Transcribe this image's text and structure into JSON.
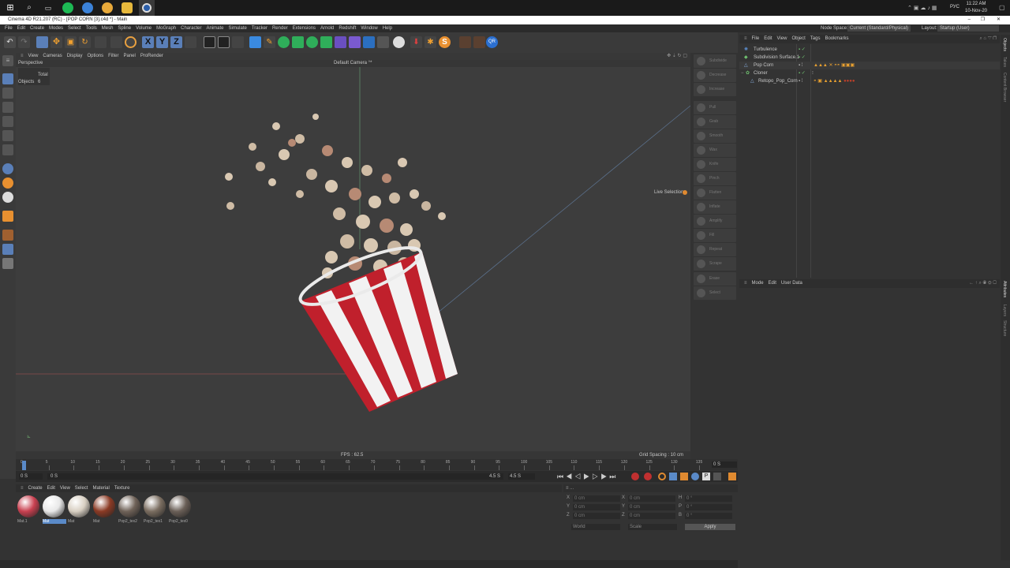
{
  "taskbar": {
    "time": "11:22 AM",
    "date": "10-Nov-20",
    "lang": "РУС"
  },
  "window": {
    "title": "Cinema 4D R21.207 (RC) - [POP CORN [3].c4d *] - Main"
  },
  "menu": [
    "File",
    "Edit",
    "Create",
    "Modes",
    "Select",
    "Tools",
    "Mesh",
    "Spline",
    "Volume",
    "MoGraph",
    "Character",
    "Animate",
    "Simulate",
    "Tracker",
    "Render",
    "Extensions",
    "Arnold",
    "Redshift",
    "Window",
    "Help"
  ],
  "nodespace": {
    "label": "Node Space:",
    "value": "Current (Standard/Physical)"
  },
  "layout": {
    "label": "Layout:",
    "value": "Startup (User)"
  },
  "viewport": {
    "menu": [
      "View",
      "Cameras",
      "Display",
      "Options",
      "Filter",
      "Panel",
      "ProRender"
    ],
    "projection": "Perspective",
    "camera": "Default Camera °*",
    "stats_total": "Total",
    "stats_objects_label": "Objects",
    "stats_objects_value": "6",
    "live_selection": "Live Selection",
    "fps": "FPS : 62.5",
    "grid_spacing": "Grid Spacing : 10 cm"
  },
  "sculpt": [
    "Subdivide",
    "Decrease",
    "Increase",
    "Pull",
    "Grab",
    "Smooth",
    "Wax",
    "Knife",
    "Pinch",
    "Flatten",
    "Inflate",
    "Amplify",
    "Fill",
    "Repeat",
    "Scrape",
    "Erase",
    "Select"
  ],
  "objects": {
    "menu": [
      "File",
      "Edit",
      "View",
      "Object",
      "Tags",
      "Bookmarks"
    ],
    "rows": [
      {
        "name": "Turbulence",
        "indent": 0
      },
      {
        "name": "Subdivision Surface.1",
        "indent": 0
      },
      {
        "name": "Pop Corn",
        "indent": 0
      },
      {
        "name": "Cloner",
        "indent": 0
      },
      {
        "name": "Retopo_Pop_Corn",
        "indent": 1
      }
    ]
  },
  "attributes": {
    "menu": [
      "Mode",
      "Edit",
      "User Data"
    ]
  },
  "right_tabs": [
    "Objects",
    "Takes",
    "Content Browser",
    "Attributes",
    "Layers",
    "Structure"
  ],
  "timeline": {
    "ticks": [
      "0",
      "5",
      "10",
      "15",
      "20",
      "25",
      "30",
      "35",
      "40",
      "45",
      "50",
      "55",
      "60",
      "65",
      "70",
      "75",
      "80",
      "85",
      "90",
      "95",
      "100",
      "105",
      "110",
      "115",
      "120",
      "125",
      "130",
      "135"
    ],
    "end_field": "0 S",
    "start": "0 S",
    "start2": "0 S",
    "end_a": "4.5 S",
    "end_b": "4.5 S"
  },
  "materials": {
    "menu": [
      "Create",
      "Edit",
      "View",
      "Select",
      "Material",
      "Texture"
    ],
    "items": [
      {
        "label": "Mat.1",
        "color": "#c94050"
      },
      {
        "label": "Mat",
        "color": "#e8e8e8"
      },
      {
        "label": "Mat",
        "color": "#d8cfc2"
      },
      {
        "label": "Mat",
        "color": "#8b3a24"
      },
      {
        "label": "Pop2_tex2",
        "color": "#6f6258"
      },
      {
        "label": "Pop2_tex1",
        "color": "#7a6d60"
      },
      {
        "label": "Pop2_tex0",
        "color": "#6a5f57"
      }
    ]
  },
  "coords": {
    "rows": [
      {
        "a": "X",
        "va": "0 cm",
        "b": "X",
        "vb": "0 cm",
        "c": "H",
        "vc": "0 °"
      },
      {
        "a": "Y",
        "va": "0 cm",
        "b": "Y",
        "vb": "0 cm",
        "c": "P",
        "vc": "0 °"
      },
      {
        "a": "Z",
        "va": "0 cm",
        "b": "Z",
        "vb": "0 cm",
        "c": "B",
        "vc": "0 °"
      }
    ],
    "world": "World",
    "scale": "Scale",
    "apply": "Apply"
  },
  "colors": {
    "accent": "#5a8ac8",
    "red_stripe": "#c0202c"
  }
}
